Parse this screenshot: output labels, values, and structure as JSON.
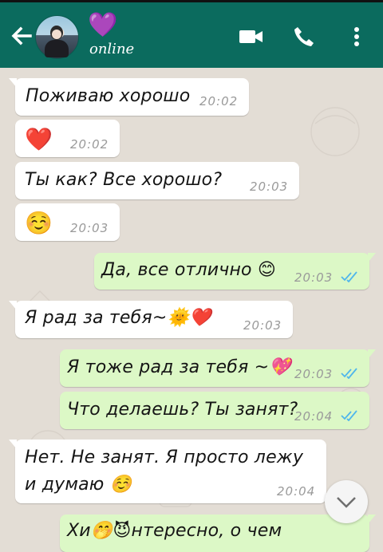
{
  "header": {
    "contact_name": "💜",
    "status": "online",
    "accent_color": "#0b6b5e"
  },
  "messages": [
    {
      "text": "Поживаю хорошо",
      "time": "20:02",
      "direction": "incoming"
    },
    {
      "text": "❤️",
      "time": "20:02",
      "direction": "incoming"
    },
    {
      "text": "Ты как?  Все хорошо?",
      "time": "20:03",
      "direction": "incoming"
    },
    {
      "text": "☺️",
      "time": "20:03",
      "direction": "incoming"
    },
    {
      "text": "Да,  все отлично 😊",
      "time": "20:03",
      "direction": "outgoing"
    },
    {
      "text": "Я рад за тебя~🌞❤️",
      "time": "20:03",
      "direction": "incoming"
    },
    {
      "text": "Я тоже рад за тебя ~💖",
      "time": "20:03",
      "direction": "outgoing"
    },
    {
      "text": "Что делаешь? Ты занят?",
      "time": "20:04",
      "direction": "outgoing"
    },
    {
      "text": "Нет.  Не занят. Я просто лежу",
      "text2": "и думаю ☺️",
      "time": "20:04",
      "direction": "incoming"
    },
    {
      "text": "Хи🤭😈нтересно, о чем",
      "direction": "outgoing"
    }
  ],
  "icons": [
    "back-arrow-icon",
    "video-call-icon",
    "phone-icon",
    "more-vert-icon",
    "double-check-icon",
    "chevron-down-icon"
  ]
}
